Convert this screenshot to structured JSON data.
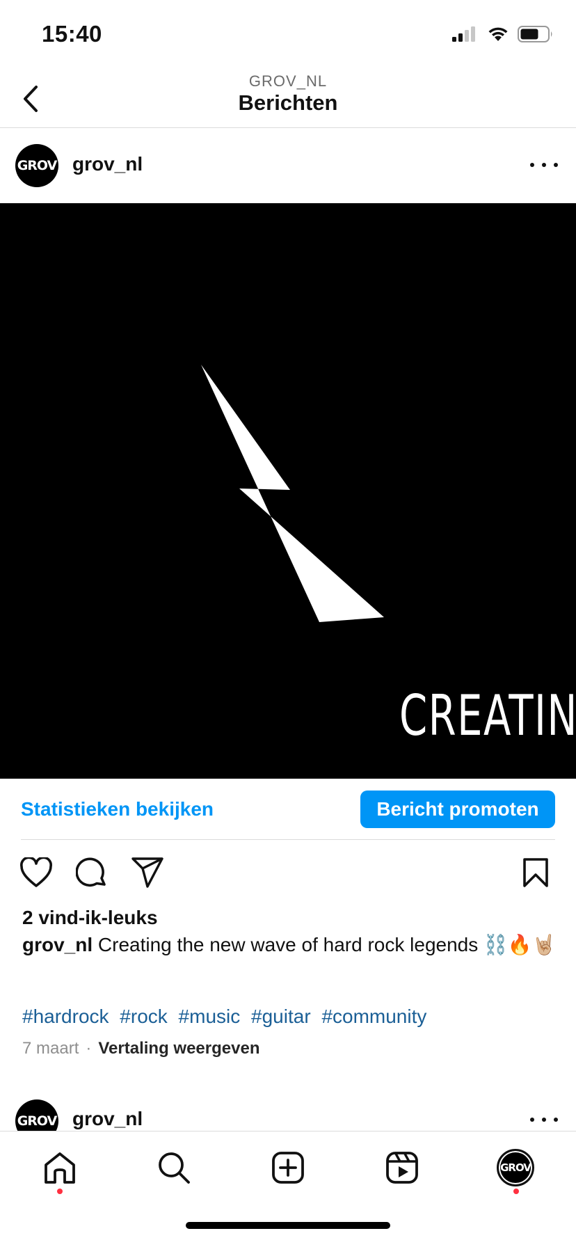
{
  "status_bar": {
    "time": "15:40",
    "icons": [
      "signal-icon",
      "wifi-icon",
      "battery-icon"
    ]
  },
  "header": {
    "subtitle": "GROV_NL",
    "title": "Berichten",
    "back_icon": "chevron-left-icon"
  },
  "post": {
    "avatar_text": "GROV",
    "username": "grov_nl",
    "image": {
      "overlay_text": "CREATING",
      "graphic": "lightning-bolt",
      "background": "#000000"
    },
    "stats_link": "Statistieken bekijken",
    "promote_button": "Bericht promoten",
    "likes": "2 vind-ik-leuks",
    "caption_user": "grov_nl",
    "caption_text": "Creating the new wave of hard rock legends ⛓️🔥🤘🏼",
    "hashtags": [
      "#hardrock",
      "#rock",
      "#music",
      "#guitar",
      "#community"
    ],
    "date": "7 maart",
    "separator": "·",
    "translate_link": "Vertaling weergeven"
  },
  "next_post": {
    "avatar_text": "GROV",
    "username": "grov_nl"
  },
  "tab_bar": {
    "tabs": [
      "home-icon",
      "search-icon",
      "create-icon",
      "reels-icon",
      "profile"
    ],
    "profile_avatar_text": "GROV"
  },
  "colors": {
    "accent": "#0095f6",
    "hashtag": "#1b5f96",
    "notification_dot": "#ff3040"
  }
}
